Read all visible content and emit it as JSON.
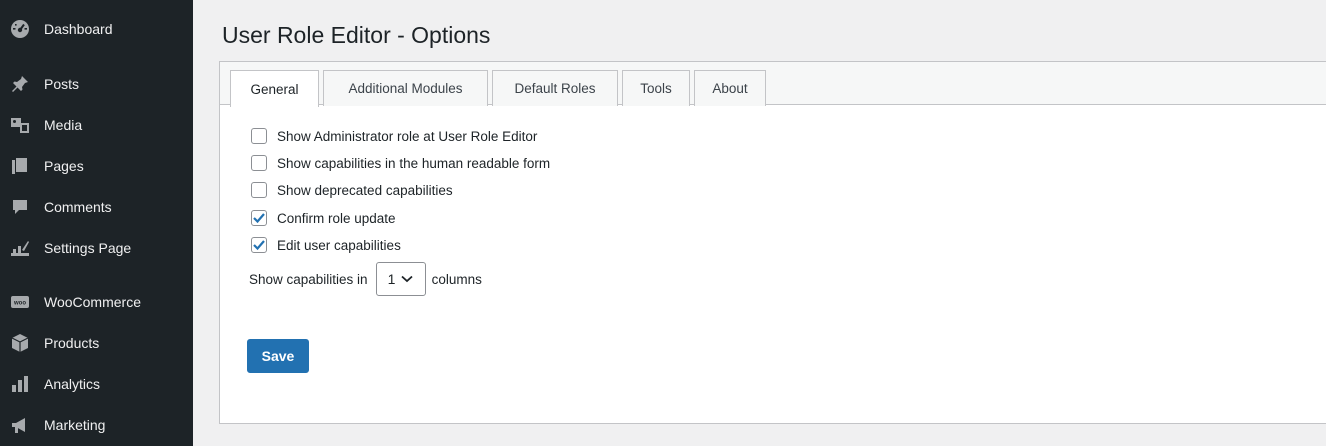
{
  "sidebar": {
    "items": [
      {
        "label": "Dashboard",
        "icon": "dashboard-icon"
      },
      {
        "label": "Posts",
        "icon": "pin-icon"
      },
      {
        "label": "Media",
        "icon": "media-icon"
      },
      {
        "label": "Pages",
        "icon": "pages-icon"
      },
      {
        "label": "Comments",
        "icon": "comment-icon"
      },
      {
        "label": "Settings Page",
        "icon": "chart-settings-icon"
      },
      {
        "label": "WooCommerce",
        "icon": "woo-icon"
      },
      {
        "label": "Products",
        "icon": "box-icon"
      },
      {
        "label": "Analytics",
        "icon": "bar-chart-icon"
      },
      {
        "label": "Marketing",
        "icon": "megaphone-icon"
      }
    ]
  },
  "page": {
    "title": "User Role Editor - Options"
  },
  "tabs": [
    "General",
    "Additional Modules",
    "Default Roles",
    "Tools",
    "About"
  ],
  "options": [
    {
      "label": "Show Administrator role at User Role Editor",
      "checked": false
    },
    {
      "label": "Show capabilities in the human readable form",
      "checked": false
    },
    {
      "label": "Show deprecated capabilities",
      "checked": false
    },
    {
      "label": "Confirm role update",
      "checked": true
    },
    {
      "label": "Edit user capabilities",
      "checked": true
    }
  ],
  "columns": {
    "prefix": "Show capabilities in",
    "value": "1",
    "suffix": "columns"
  },
  "save_label": "Save",
  "colors": {
    "sidebar": "#1d2327",
    "accent": "#2271b1",
    "background": "#f0f0f1"
  }
}
